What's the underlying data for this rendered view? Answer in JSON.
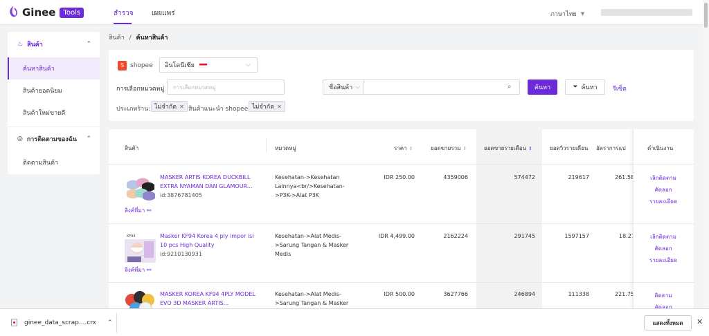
{
  "header": {
    "brand": "Ginee",
    "badge": "Tools",
    "tabs": [
      {
        "label": "สำรวจ",
        "active": true
      },
      {
        "label": "เผยแพร่",
        "active": false
      }
    ],
    "language": "ภาษาไทย",
    "accent_color": "#6c2bd9"
  },
  "sidebar": {
    "group1": "สินค้า",
    "items1": [
      "ค้นหาสินค้า",
      "สินค้ายอดนิยม",
      "สินค้าใหม่ขายดี"
    ],
    "group2": "การติดตามของฉัน",
    "items2": [
      "ติดตามสินค้า"
    ]
  },
  "breadcrumb": {
    "root": "สินค้า",
    "sep": "/",
    "current": "ค้นหาสินค้า"
  },
  "filters": {
    "platform": "shopee",
    "country": "อินโดนีเซีย",
    "category_label": "การเลือกหมวดหมู่ :",
    "category_placeholder": "การเลือกหมวดหมู่",
    "search_type": "ชื่อสินค้า",
    "search_value": "",
    "search_button": "ค้นหา",
    "filter_button": "ค้นหา",
    "reset": "รีเซ็ต",
    "shop_type_label": "ประเภทร้าน:",
    "shop_type_value": "ไม่จำกัด",
    "recommend_label": "สินค้าแนะนำ shopee:",
    "recommend_value": "ไม่จำกัด"
  },
  "table": {
    "headers": {
      "product": "สินค้า",
      "category": "หมวดหมู่",
      "price": "ราคา",
      "total_sales": "ยอดขายรวม",
      "monthly_sales": "ยอดขายรายเดือน",
      "monthly_views": "ยอดวิวรายเดือน",
      "conversion": "อัตราการแป",
      "actions": "ดำเนินงาน"
    },
    "rows": [
      {
        "name": "MASKER ARTIS KOREA DUCKBILL EXTRA NYAMAN DAN GLAMOUR...",
        "id": "id:3876781405",
        "link": "ลิงค์ที่มา",
        "category": "Kesehatan->Kesehatan Lainnya<br/>Kesehatan->P3K->Alat P3K",
        "price": "IDR 250.00",
        "total_sales": "4359006",
        "monthly_sales": "574472",
        "monthly_views": "219617",
        "conversion": "261.58"
      },
      {
        "name": "Masker KF94 Korea 4 ply impor isi 10 pcs High Quality",
        "id": "id:9210130931",
        "link": "ลิงค์ที่มา",
        "category": "Kesehatan->Alat Medis->Sarung Tangan & Masker Medis",
        "price": "IDR 4,499.00",
        "total_sales": "2162224",
        "monthly_sales": "291745",
        "monthly_views": "1597157",
        "conversion": "18.27"
      },
      {
        "name": "MASKER KOREA KF94 4PLY MODEL EVO 3D MASKER ARTIS...",
        "id": "",
        "link": "",
        "category": "Kesehatan->Alat Medis->Sarung Tangan & Masker",
        "price": "IDR 500.00",
        "total_sales": "3627766",
        "monthly_sales": "246894",
        "monthly_views": "111338",
        "conversion": "221.75"
      }
    ],
    "actions": [
      "เลิกติดตาม",
      "คัดลอก",
      "รายละเอียด"
    ],
    "row3_actions": [
      "ติดตาม",
      "คัดลอก"
    ]
  },
  "downloads": {
    "file": "ginee_data_scrap....crx",
    "show_all": "แสดงทั้งหมด"
  }
}
